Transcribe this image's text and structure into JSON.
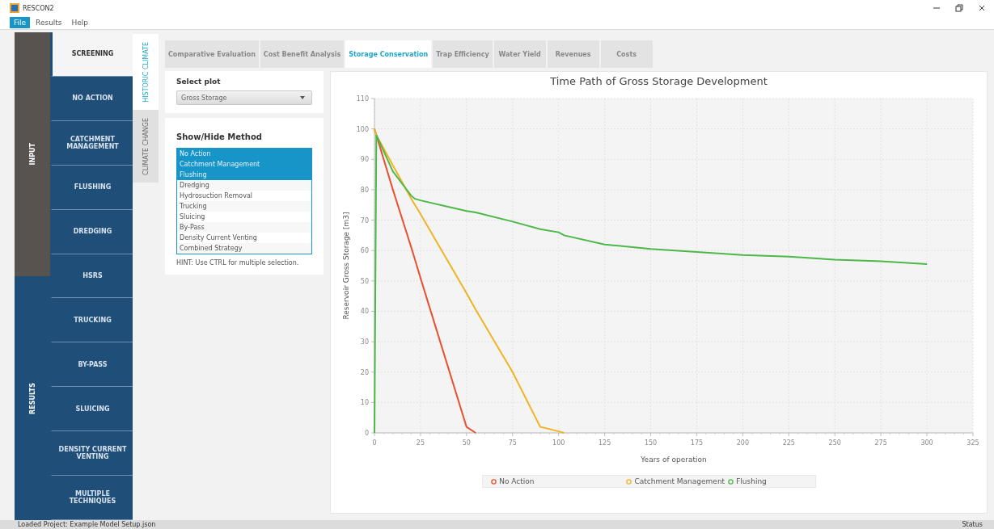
{
  "window": {
    "title": "RESCON2"
  },
  "menu": [
    {
      "label": "File",
      "selected": true
    },
    {
      "label": "Results",
      "selected": false
    },
    {
      "label": "Help",
      "selected": false
    }
  ],
  "sections": [
    {
      "label": "INPUT",
      "color": "#58534f"
    },
    {
      "label": "RESULTS",
      "color": "#1f4e79"
    }
  ],
  "nav": [
    {
      "label": "SCREENING",
      "selected": true
    },
    {
      "label": "NO ACTION",
      "selected": false
    },
    {
      "label": "CATCHMENT MANAGEMENT",
      "selected": false
    },
    {
      "label": "FLUSHING",
      "selected": false
    },
    {
      "label": "DREDGING",
      "selected": false
    },
    {
      "label": "HSRS",
      "selected": false
    },
    {
      "label": "TRUCKING",
      "selected": false
    },
    {
      "label": "BY-PASS",
      "selected": false
    },
    {
      "label": "SLUICING",
      "selected": false
    },
    {
      "label": "DENSITY CURRENT VENTING",
      "selected": false
    },
    {
      "label": "MULTIPLE TECHNIQUES",
      "selected": false
    }
  ],
  "climate_tabs": [
    {
      "label": "HISTORIC CLIMATE",
      "selected": true
    },
    {
      "label": "CLIMATE CHANGE",
      "selected": false
    }
  ],
  "tabs": [
    {
      "label": "Comparative Evaluation",
      "selected": false
    },
    {
      "label": "Cost Benefit Analysis",
      "selected": false
    },
    {
      "label": "Storage Conservation",
      "selected": true
    },
    {
      "label": "Trap Efficiency",
      "selected": false
    },
    {
      "label": "Water Yield",
      "selected": false
    },
    {
      "label": "Revenues",
      "selected": false
    },
    {
      "label": "Costs",
      "selected": false
    }
  ],
  "select_plot": {
    "title": "Select plot",
    "value": "Gross Storage"
  },
  "methods": {
    "title": "Show/Hide Method",
    "items": [
      {
        "label": "No Action",
        "selected": true
      },
      {
        "label": "Catchment Management",
        "selected": true
      },
      {
        "label": "Flushing",
        "selected": true
      },
      {
        "label": "Dredging",
        "selected": false
      },
      {
        "label": "Hydrosuction Removal",
        "selected": false
      },
      {
        "label": "Trucking",
        "selected": false
      },
      {
        "label": "Sluicing",
        "selected": false
      },
      {
        "label": "By-Pass",
        "selected": false
      },
      {
        "label": "Density Current Venting",
        "selected": false
      },
      {
        "label": "Combined Strategy",
        "selected": false
      }
    ],
    "hint": "HINT: Use CTRL for  multiple selection."
  },
  "chart": {
    "chart_data": {
      "type": "line",
      "title": "Time Path of Gross Storage Development",
      "xlabel": "Years of operation",
      "ylabel": "Reservoir Gross Storage [m3]",
      "x": [
        0,
        1,
        10,
        20,
        22,
        25,
        50,
        55,
        75,
        90,
        100,
        103,
        125,
        150,
        175,
        200,
        225,
        250,
        275,
        300
      ],
      "series": [
        {
          "name": "No Action",
          "color": "#e8502f",
          "values": [
            100,
            98,
            80,
            61,
            57,
            51,
            2,
            0,
            null,
            null,
            null,
            null,
            null,
            null,
            null,
            null,
            null,
            null,
            null,
            null
          ]
        },
        {
          "name": "Catchment Management",
          "color": "#f0b323",
          "values": [
            100,
            98,
            88,
            77,
            75,
            72,
            46,
            40.5,
            20,
            2,
            0.5,
            0,
            null,
            null,
            null,
            null,
            null,
            null,
            null,
            null
          ]
        },
        {
          "name": "Flushing",
          "color": "#4cb848",
          "values": [
            0,
            98,
            86,
            78,
            77,
            76.5,
            73,
            72.5,
            69.5,
            67,
            66,
            65,
            62,
            60.5,
            59.5,
            58.5,
            58,
            57,
            56.5,
            55.5
          ]
        }
      ],
      "xlim": [
        0,
        325
      ],
      "ylim": [
        0,
        110
      ],
      "xticks": [
        0,
        25,
        50,
        75,
        100,
        125,
        150,
        175,
        200,
        225,
        250,
        275,
        300,
        325
      ],
      "yticks": [
        0,
        10,
        20,
        30,
        40,
        50,
        60,
        70,
        80,
        90,
        100,
        110
      ],
      "grid": true
    }
  },
  "status_bar": {
    "project": "Loaded Project: Example Model Setup.json",
    "status": "Status"
  }
}
